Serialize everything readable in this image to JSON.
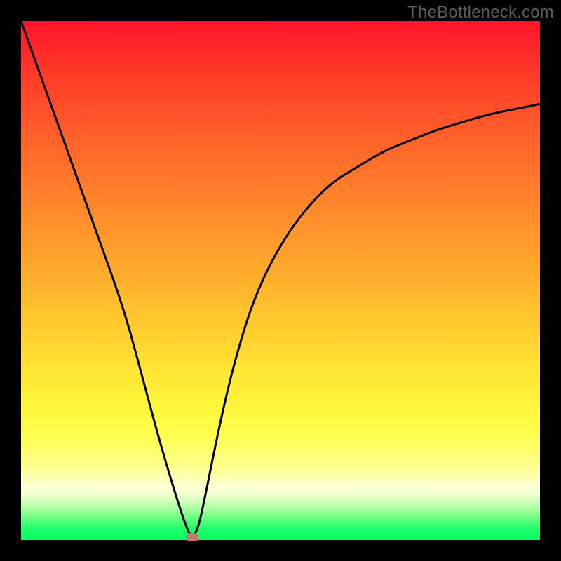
{
  "attribution": "TheBottleneck.com",
  "chart_data": {
    "type": "line",
    "title": "",
    "xlabel": "",
    "ylabel": "",
    "xlim": [
      0,
      100
    ],
    "ylim": [
      0,
      100
    ],
    "grid": false,
    "legend": false,
    "background": "rainbow-vertical-gradient",
    "gradient_stops": [
      {
        "pos": 0,
        "color": "#ff1429"
      },
      {
        "pos": 50,
        "color": "#ffa42c"
      },
      {
        "pos": 80,
        "color": "#ffff50"
      },
      {
        "pos": 100,
        "color": "#08ff5e"
      }
    ],
    "series": [
      {
        "name": "bottleneck-curve",
        "x": [
          0,
          5,
          10,
          15,
          20,
          24,
          27,
          30,
          32,
          33,
          34,
          35,
          38,
          41,
          45,
          50,
          55,
          60,
          65,
          70,
          75,
          80,
          85,
          90,
          95,
          100
        ],
        "values": [
          100,
          86,
          72,
          58,
          44,
          29,
          18,
          8,
          2,
          0.5,
          2,
          6,
          21,
          34,
          47,
          57,
          64,
          69,
          72,
          75,
          77,
          79,
          80.5,
          82,
          83,
          84
        ]
      }
    ],
    "marker": {
      "name": "optimum-dot",
      "x": 33,
      "y": 0,
      "color": "#c97a6a",
      "shape": "rounded-rect"
    }
  }
}
